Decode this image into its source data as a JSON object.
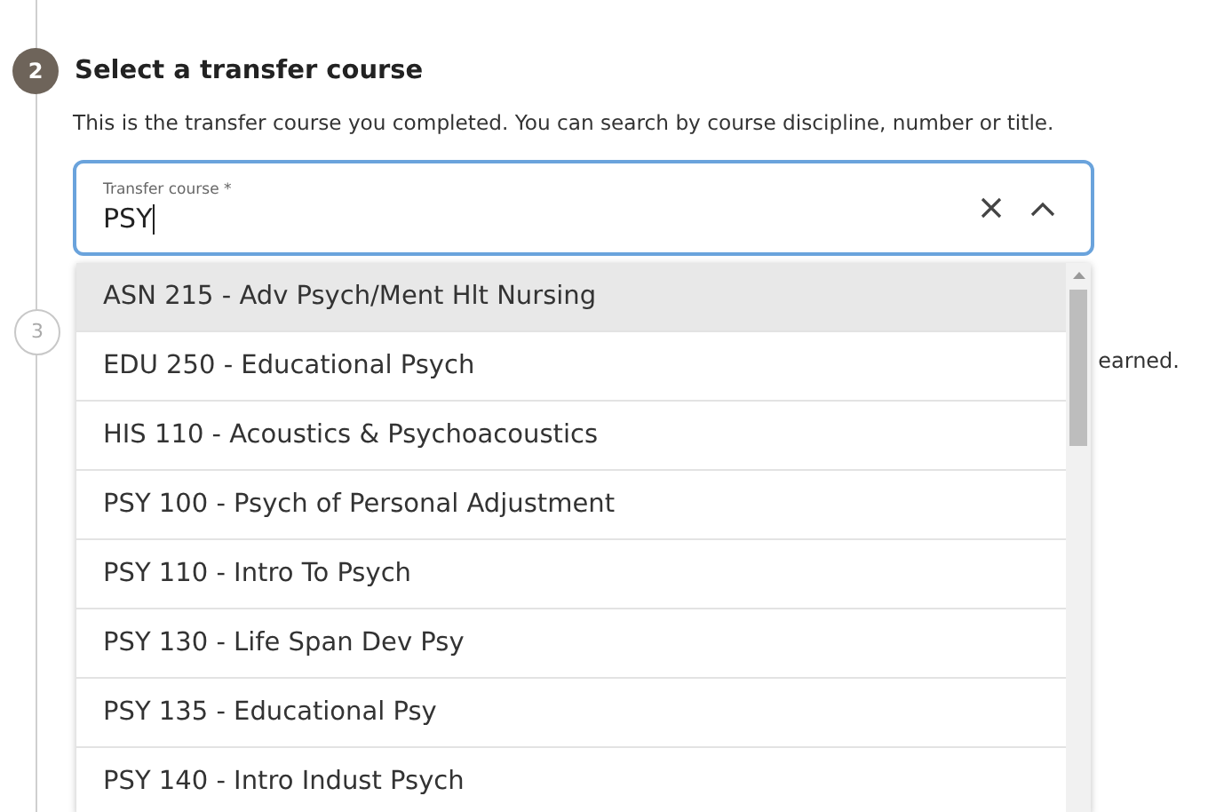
{
  "steps": [
    {
      "number": "2",
      "kind": "current",
      "title": "Select a transfer course",
      "description": "This is the transfer course you completed. You can search by course discipline, number or title."
    },
    {
      "number": "3",
      "kind": "upcoming",
      "description": "earned."
    }
  ],
  "field": {
    "label": "Transfer course *",
    "value": "PSY",
    "expanded": true
  },
  "options": [
    {
      "label": "ASN 215 - Adv Psych/Ment Hlt Nursing",
      "selected": true
    },
    {
      "label": "EDU 250 - Educational Psych",
      "selected": false
    },
    {
      "label": "HIS 110 - Acoustics & Psychoacoustics",
      "selected": false
    },
    {
      "label": "PSY 100 - Psych of Personal Adjustment",
      "selected": false
    },
    {
      "label": "PSY 110 - Intro To Psych",
      "selected": false
    },
    {
      "label": "PSY 130 - Life Span Dev Psy",
      "selected": false
    },
    {
      "label": "PSY 135 - Educational Psy",
      "selected": false
    },
    {
      "label": "PSY 140 - Intro Indust Psych",
      "selected": false
    }
  ]
}
